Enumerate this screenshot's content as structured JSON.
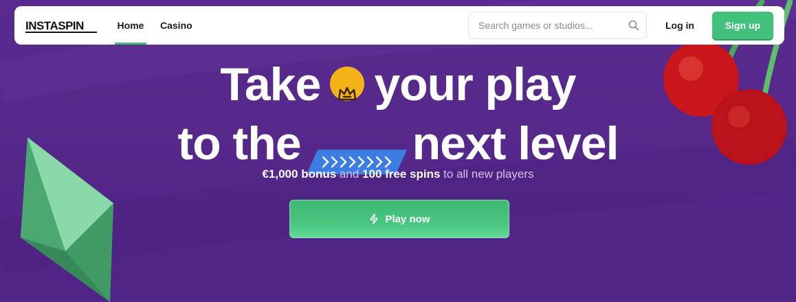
{
  "nav": {
    "logo": "INSTASPIN",
    "links": [
      "Home",
      "Casino"
    ],
    "search_placeholder": "Search games or studios...",
    "login": "Log in",
    "signup": "Sign up"
  },
  "hero": {
    "line1_a": "Take",
    "line1_b": "your play",
    "line2_a": "to the",
    "line2_b": "next level",
    "sub_bonus": "€1,000 bonus",
    "sub_and": "and",
    "sub_spins": "100 free spins",
    "sub_rest": "to all new players",
    "cta": "Play now"
  },
  "icons": [
    "search-icon",
    "crown-icon",
    "chevrons-icon",
    "bolt-icon"
  ],
  "colors": {
    "background": "#55288a",
    "accent_green": "#43c07b",
    "crown_yellow": "#f5b31a",
    "chevron_blue": "#3b7de0"
  }
}
